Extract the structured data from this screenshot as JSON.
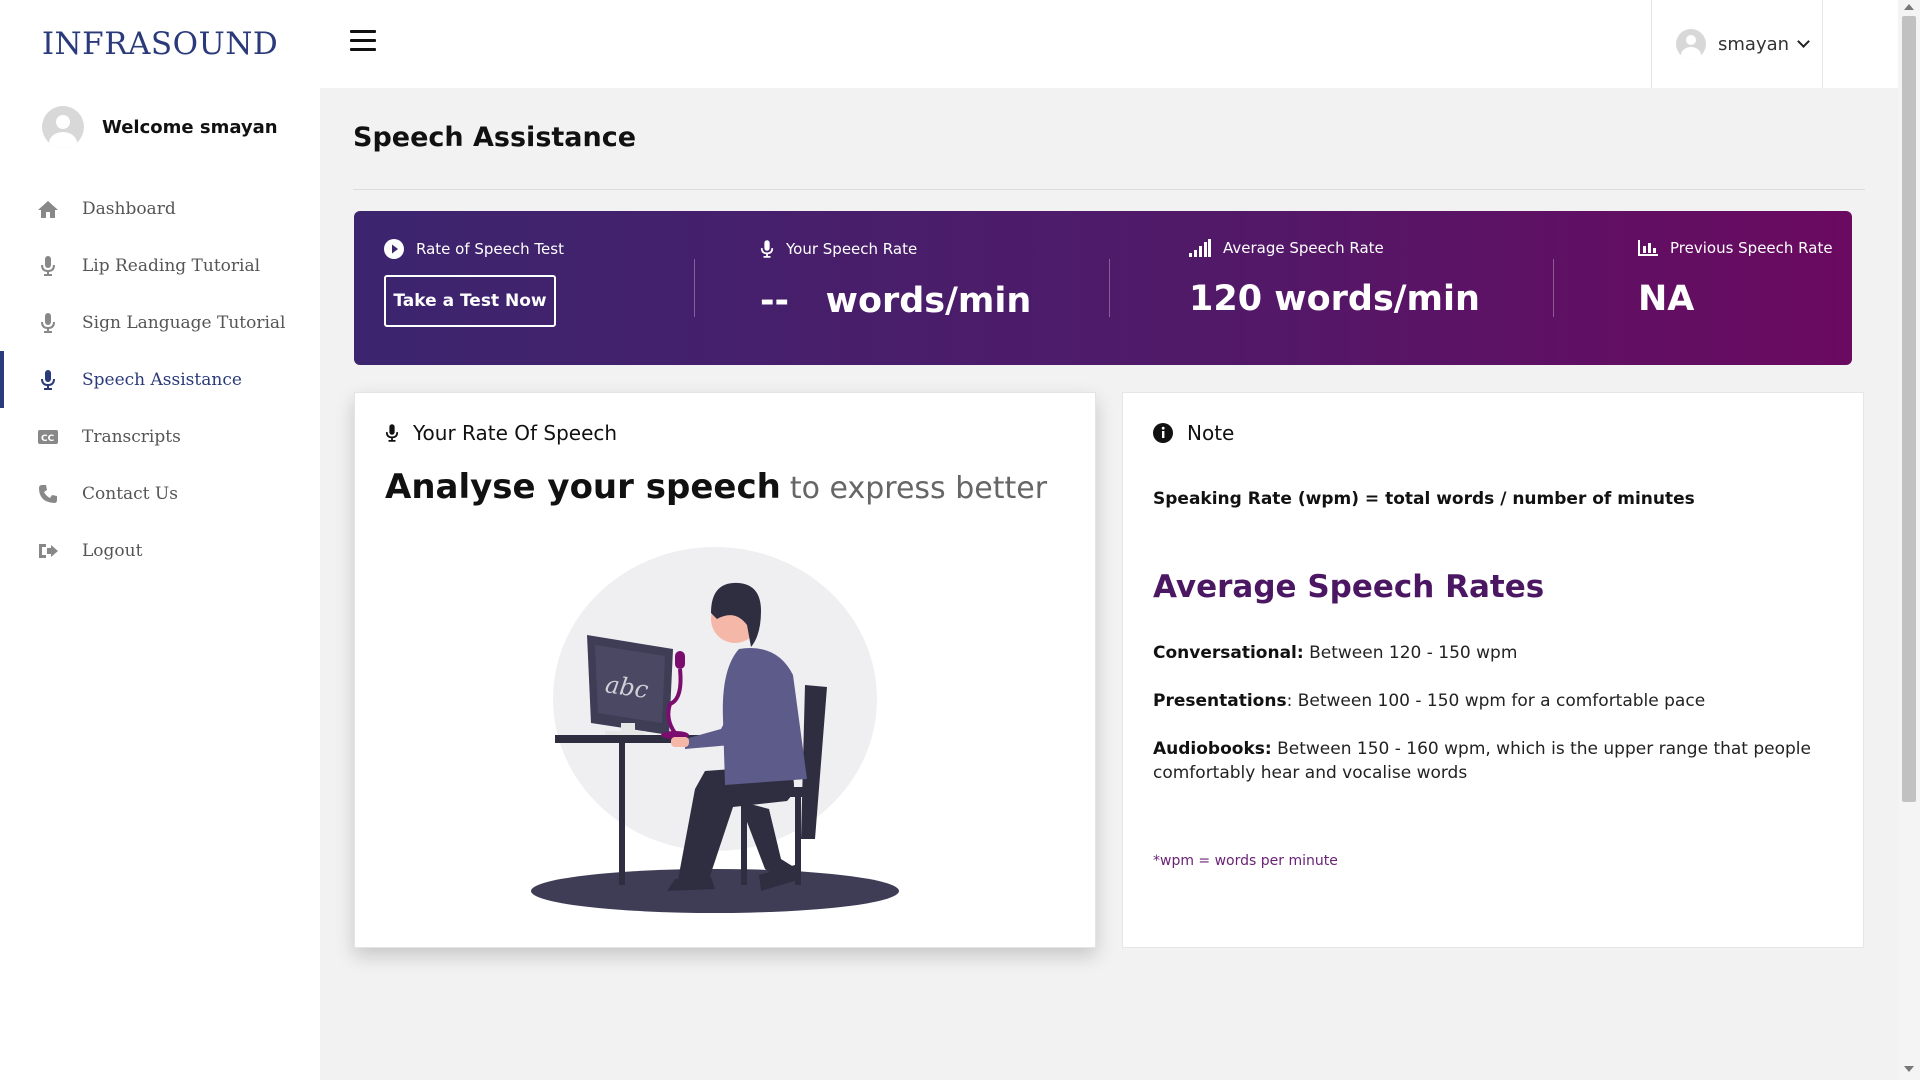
{
  "brand": "INFRASOUND",
  "user": {
    "name": "smayan",
    "welcome": "Welcome smayan"
  },
  "sidebar": {
    "items": [
      {
        "label": "Dashboard",
        "icon": "home-icon"
      },
      {
        "label": "Lip Reading Tutorial",
        "icon": "microphone-icon"
      },
      {
        "label": "Sign Language Tutorial",
        "icon": "microphone-icon"
      },
      {
        "label": "Speech Assistance",
        "icon": "microphone-icon",
        "active": true
      },
      {
        "label": "Transcripts",
        "icon": "closed-captions-icon"
      },
      {
        "label": "Contact Us",
        "icon": "phone-icon"
      },
      {
        "label": "Logout",
        "icon": "sign-out-icon"
      }
    ]
  },
  "page": {
    "title": "Speech Assistance"
  },
  "banner": {
    "test_label": "Rate of Speech Test",
    "test_button": "Take a Test Now",
    "your_rate_label": "Your Speech Rate",
    "your_rate_value": "--   words/min",
    "average_rate_label": "Average Speech Rate",
    "average_rate_value": "120 words/min",
    "previous_rate_label": "Previous Speech Rate",
    "previous_rate_value": "NA"
  },
  "left_card": {
    "heading": "Your Rate Of Speech",
    "headline_bold": "Analyse your speech",
    "headline_light": "to express better",
    "screen_text": "abc"
  },
  "note_card": {
    "heading": "Note",
    "formula": "Speaking Rate (wpm) = total words / number of minutes",
    "avg_title": "Average Speech Rates",
    "rates": [
      {
        "label": "Conversational:",
        "text": " Between 120 - 150 wpm"
      },
      {
        "label": "Presentations",
        "text": ": Between 100 - 150 wpm for a comfortable pace"
      },
      {
        "label": "Audiobooks:",
        "text": " Between 150 - 160 wpm, which is the upper range that people comfortably hear and vocalise words"
      }
    ],
    "footnote": "*wpm = words per minute"
  },
  "colors": {
    "brand": "#2a3a7a",
    "banner_start": "#3c256e",
    "banner_end": "#6a0a60",
    "accent_purple": "#4b1763"
  }
}
